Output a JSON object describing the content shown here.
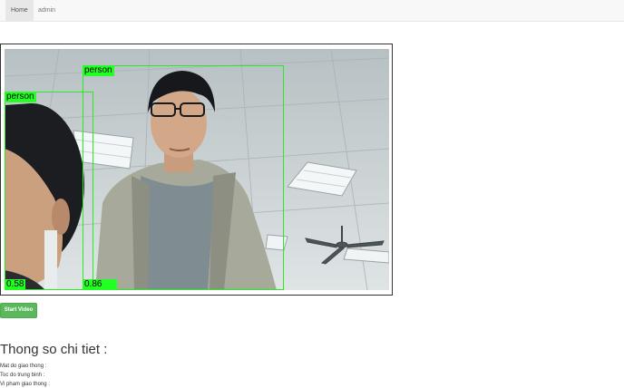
{
  "nav": {
    "items": [
      {
        "label": "Home",
        "active": true
      },
      {
        "label": "admin",
        "active": false
      }
    ]
  },
  "video": {
    "detections": [
      {
        "label": "person",
        "score": "0.58"
      },
      {
        "label": "person",
        "score": "0.86"
      }
    ],
    "box_color": "#22ee22"
  },
  "controls": {
    "start_label": "Start Video",
    "start_color": "#5cb85c"
  },
  "stats": {
    "title": "Thong so chi tiet :",
    "lines": [
      "Mat do giao thong :",
      "Toc do trung binh :",
      "Vi pham giao thong :"
    ]
  }
}
